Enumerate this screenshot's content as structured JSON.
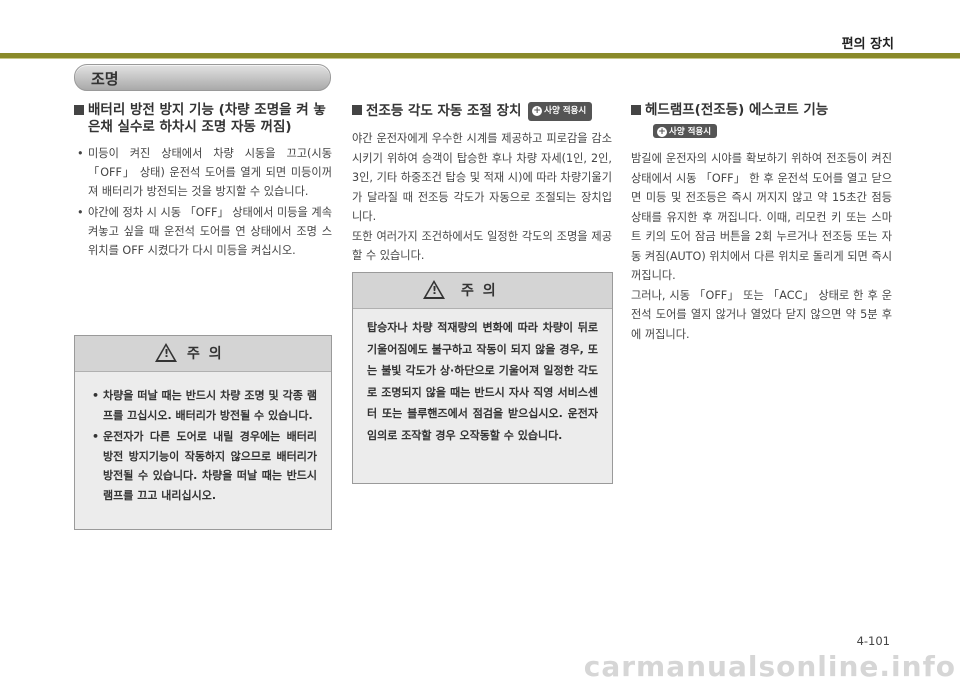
{
  "header": {
    "section_title": "편의 장치"
  },
  "category_label": "조명",
  "badge_label": "사양 적용시",
  "col1": {
    "heading": "배터리 방전 방지 기능 (차량 조명을 켜 놓은채 실수로 하차시 조명 자동 꺼짐)",
    "items": [
      "미등이 켜진 상태에서 차량 시동을 끄고(시동 「OFF」 상태) 운전석 도어를 열게 되면 미등이꺼져 배터리가 방전되는 것을 방지할 수 있습니다.",
      "야간에 정차 시 시동 「OFF」 상태에서 미등을 계속 켜놓고 싶을 때 운전석 도어를 연 상태에서 조명 스위치를 OFF 시켰다가 다시 미등을 켜십시오."
    ],
    "caution": {
      "title": "주 의",
      "items": [
        "차량을 떠날 때는 반드시 차량 조명 및 각종 램프를 끄십시오. 배터리가 방전될 수 있습니다.",
        "운전자가 다른 도어로 내릴 경우에는 배터리 방전 방지기능이 작동하지 않으므로 배터리가 방전될 수 있습니다. 차량을 떠날 때는 반드시 램프를 끄고 내리십시오."
      ]
    }
  },
  "col2": {
    "heading": "전조등 각도 자동 조절 장치",
    "paragraphs": [
      "야간 운전자에게 우수한 시계를 제공하고 피로감을 감소시키기 위하여 승객이 탑승한 후나 차량 자세(1인, 2인, 3인, 기타 하중조건 탑승 및 적재 시)에 따라 차량기울기가 달라질 때 전조등 각도가 자동으로 조절되는 장치입니다.",
      "또한 여러가지 조건하에서도 일정한 각도의 조명을 제공할 수 있습니다."
    ],
    "caution": {
      "title": "주 의",
      "text": "탑승자나 차량 적재량의 변화에 따라 차량이 뒤로 기울어짐에도 불구하고 작동이 되지 않을 경우, 또는 불빛 각도가 상·하단으로 기울어져 일정한 각도로 조명되지 않을 때는 반드시 자사 직영 서비스센터 또는 블루핸즈에서 점검을 받으십시오. 운전자 임의로 조작할 경우 오작동할 수 있습니다."
    }
  },
  "col3": {
    "heading": "헤드램프(전조등) 에스코트 기능",
    "paragraphs": [
      "밤길에 운전자의 시야를 확보하기 위하여 전조등이 켜진 상태에서 시동 「OFF」 한 후 운전석 도어를 열고 닫으면 미등 및 전조등은 즉시 꺼지지 않고 약 15초간 점등 상태를 유지한 후 꺼집니다. 이때, 리모컨 키 또는 스마트 키의 도어 잠금 버튼을 2회 누르거나 전조등 또는 자동 켜짐(AUTO) 위치에서 다른 위치로 돌리게 되면 즉시 꺼집니다.",
      "그러나, 시동 「OFF」 또는 「ACC」 상태로 한 후 운전석 도어를 열지 않거나 열었다 닫지 않으면 약 5분 후에 꺼집니다."
    ]
  },
  "page_number": "4-101",
  "watermark": "carmanualsonline.info",
  "colors": {
    "olive": "#8a8a2a",
    "caution_header": "#d4d4d4",
    "caution_body": "#ececec"
  },
  "icons": [
    "warning-triangle-icon",
    "plus-circle-icon"
  ]
}
